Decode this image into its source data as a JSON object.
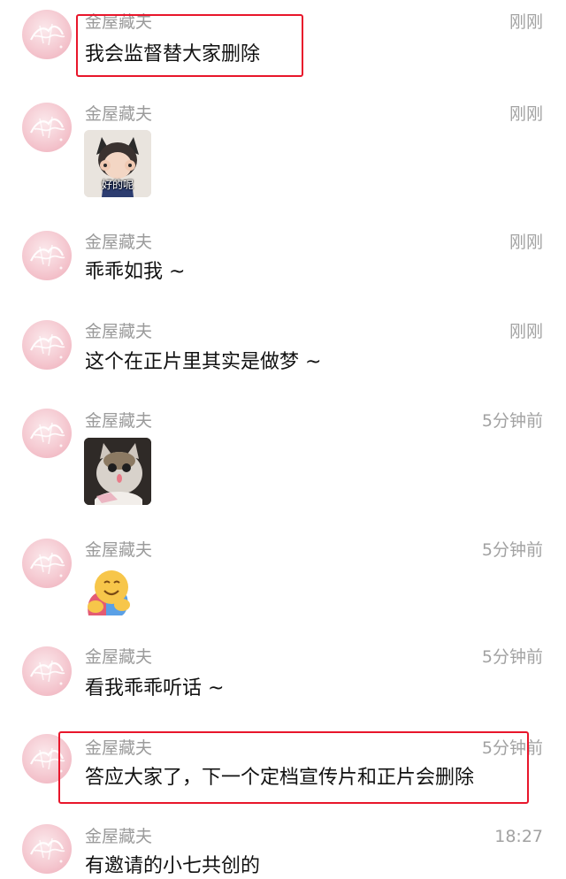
{
  "messages": [
    {
      "name": "金屋藏夫",
      "time": "刚刚",
      "text": "我会监督替大家删除"
    },
    {
      "name": "金屋藏夫",
      "time": "刚刚",
      "sticker_caption": "好的呢"
    },
    {
      "name": "金屋藏夫",
      "time": "刚刚",
      "text": "乖乖如我 ~"
    },
    {
      "name": "金屋藏夫",
      "time": "刚刚",
      "text": "这个在正片里其实是做梦 ~"
    },
    {
      "name": "金屋藏夫",
      "time": "5分钟前",
      "sticker": "cat-sticker"
    },
    {
      "name": "金屋藏夫",
      "time": "5分钟前",
      "emoji": "hugging-face-emoji"
    },
    {
      "name": "金屋藏夫",
      "time": "5分钟前",
      "text": "看我乖乖听话 ~"
    },
    {
      "name": "金屋藏夫",
      "time": "5分钟前",
      "text": "答应大家了，下一个定档宣传片和正片会删除"
    },
    {
      "name": "金屋藏夫",
      "time": "18:27",
      "text": "有邀请的小七共创的"
    }
  ],
  "colors": {
    "highlight": "#e8162b",
    "name": "#9b9b9b",
    "text": "#111111",
    "avatar": "#f2bcc6"
  }
}
